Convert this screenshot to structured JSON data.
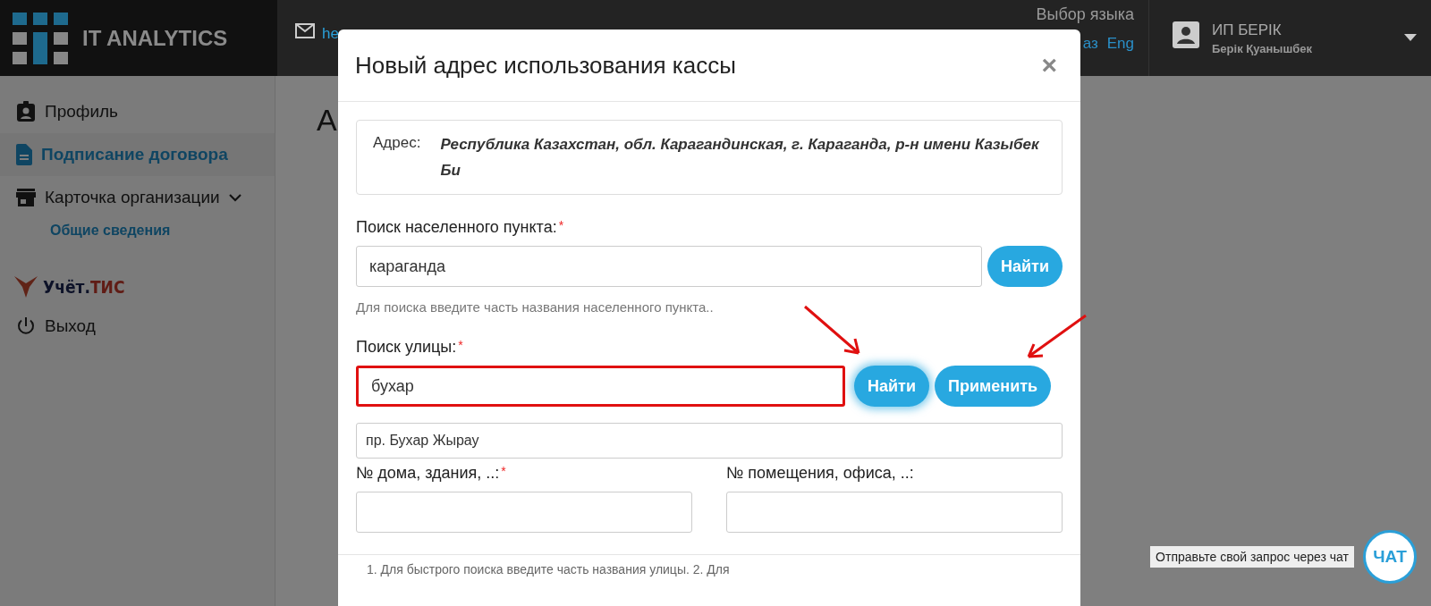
{
  "header": {
    "logo": "IT ANALYTICS",
    "email": "he",
    "language": {
      "label": "Выбор языка",
      "options": [
        {
          "label": "аз",
          "selected": false
        },
        {
          "label": "Eng",
          "selected": false
        }
      ]
    },
    "user": {
      "name": "ИП БЕРІК",
      "subtitle": "Берік Қуанышбек"
    }
  },
  "sidebar": {
    "items": [
      {
        "kind": "link",
        "label": "Профиль",
        "selected": false
      },
      {
        "kind": "link",
        "label": "Подписание договора",
        "selected": true
      },
      {
        "kind": "group",
        "label": "Карточка организации",
        "expanded": true,
        "children": [
          {
            "label": "Общие сведения",
            "selected": false
          }
        ]
      },
      {
        "kind": "brand",
        "label": "Учёт.",
        "accent": "ТИС"
      },
      {
        "kind": "link",
        "label": "Выход",
        "selected": false
      }
    ]
  },
  "page": {
    "heading": "А"
  },
  "modal": {
    "title": "Новый адрес использования кассы",
    "close": "×",
    "address": {
      "label": "Адрес:",
      "value": "Республика Казахстан, обл. Карагандинская, г. Караганда, р-н имени Казыбек Би"
    },
    "locality": {
      "label": "Поиск населенного пункта:",
      "required_mark": "*",
      "value": "караганда",
      "highlighted": false,
      "buttons": [
        {
          "label": "Найти",
          "focused": false
        }
      ],
      "hint": "Для поиска введите часть названия населенного пункта.."
    },
    "street": {
      "label": "Поиск улицы:",
      "required_mark": "*",
      "value": "бухар",
      "highlighted": true,
      "buttons": [
        {
          "label": "Найти",
          "focused": true
        },
        {
          "label": "Применить",
          "focused": false
        }
      ]
    },
    "result": "пр. Бухар Жырау",
    "details": [
      {
        "label": "№ дома, здания, ..:",
        "required_mark": "*"
      },
      {
        "label": "№ помещения, офиса, ..:"
      }
    ],
    "note": "1. Для быстрого поиска введите часть названия улицы. 2. Для"
  },
  "chat": {
    "text": "Отправьте свой запрос через чат",
    "button": "ЧАТ"
  }
}
